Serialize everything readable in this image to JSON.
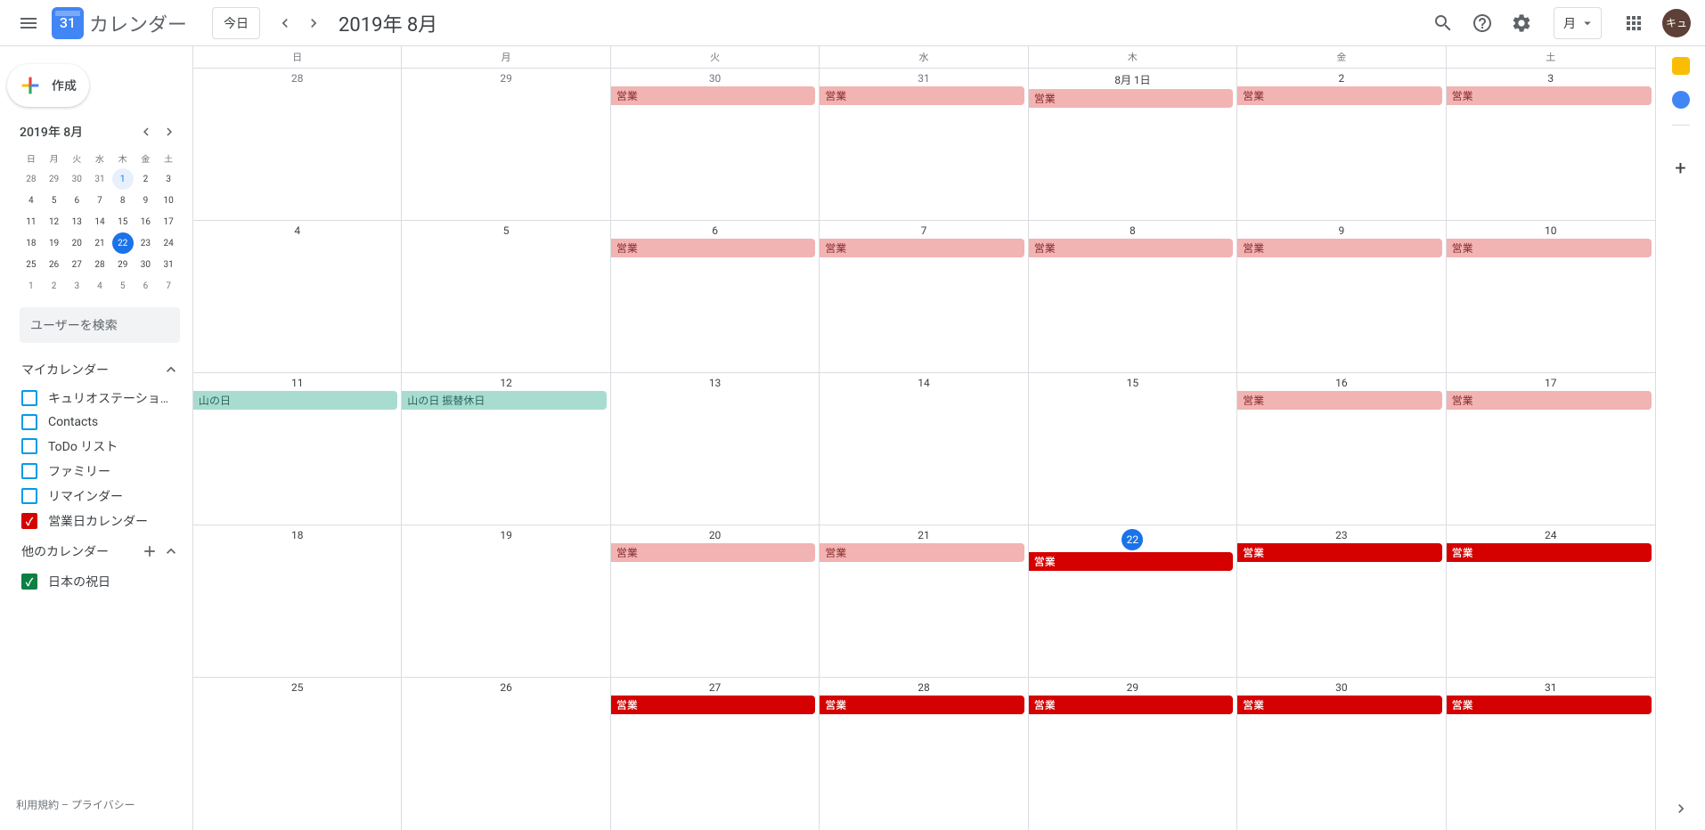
{
  "header": {
    "logo_day": "31",
    "app_title": "カレンダー",
    "today_button": "今日",
    "current_date": "2019年 8月",
    "view_label": "月",
    "avatar_initial": "キュ"
  },
  "sidebar": {
    "create_label": "作成",
    "mini_title": "2019年 8月",
    "search_placeholder": "ユーザーを検索",
    "my_cal_label": "マイカレンダー",
    "other_cal_label": "他のカレンダー",
    "dow_short": [
      "日",
      "月",
      "火",
      "水",
      "木",
      "金",
      "土"
    ],
    "mini_days": [
      [
        "28",
        "29",
        "30",
        "31",
        "1",
        "2",
        "3"
      ],
      [
        "4",
        "5",
        "6",
        "7",
        "8",
        "9",
        "10"
      ],
      [
        "11",
        "12",
        "13",
        "14",
        "15",
        "16",
        "17"
      ],
      [
        "18",
        "19",
        "20",
        "21",
        "22",
        "23",
        "24"
      ],
      [
        "25",
        "26",
        "27",
        "28",
        "29",
        "30",
        "31"
      ],
      [
        "1",
        "2",
        "3",
        "4",
        "5",
        "6",
        "7"
      ]
    ],
    "my_calendars": [
      {
        "label": "キュリオステーション志...",
        "color": "#039be5",
        "checked": false
      },
      {
        "label": "Contacts",
        "color": "#039be5",
        "checked": false
      },
      {
        "label": "ToDo リスト",
        "color": "#039be5",
        "checked": false
      },
      {
        "label": "ファミリー",
        "color": "#039be5",
        "checked": false
      },
      {
        "label": "リマインダー",
        "color": "#039be5",
        "checked": false
      },
      {
        "label": "営業日カレンダー",
        "color": "#d50000",
        "checked": true
      }
    ],
    "other_calendars": [
      {
        "label": "日本の祝日",
        "color": "#0b8043",
        "checked": true
      }
    ],
    "footer": "利用規約 – プライバシー"
  },
  "grid": {
    "dow": [
      "日",
      "月",
      "火",
      "水",
      "木",
      "金",
      "土"
    ],
    "event_labels": {
      "business": "営業",
      "mountain": "山の日",
      "mountain_sub": "山の日 振替休日"
    },
    "weeks": [
      [
        {
          "n": "28",
          "o": true
        },
        {
          "n": "29",
          "o": true
        },
        {
          "n": "30",
          "o": true,
          "e": [
            {
              "t": "business",
              "s": "pink"
            }
          ]
        },
        {
          "n": "31",
          "o": true,
          "e": [
            {
              "t": "business",
              "s": "pink"
            }
          ]
        },
        {
          "n": "8月 1日",
          "e": [
            {
              "t": "business",
              "s": "pink"
            }
          ]
        },
        {
          "n": "2",
          "e": [
            {
              "t": "business",
              "s": "pink"
            }
          ]
        },
        {
          "n": "3",
          "e": [
            {
              "t": "business",
              "s": "pink"
            }
          ]
        }
      ],
      [
        {
          "n": "4"
        },
        {
          "n": "5"
        },
        {
          "n": "6",
          "e": [
            {
              "t": "business",
              "s": "pink"
            }
          ]
        },
        {
          "n": "7",
          "e": [
            {
              "t": "business",
              "s": "pink"
            }
          ]
        },
        {
          "n": "8",
          "e": [
            {
              "t": "business",
              "s": "pink"
            }
          ]
        },
        {
          "n": "9",
          "e": [
            {
              "t": "business",
              "s": "pink"
            }
          ]
        },
        {
          "n": "10",
          "e": [
            {
              "t": "business",
              "s": "pink"
            }
          ]
        }
      ],
      [
        {
          "n": "11",
          "e": [
            {
              "t": "mountain",
              "s": "green"
            }
          ]
        },
        {
          "n": "12",
          "e": [
            {
              "t": "mountain_sub",
              "s": "green"
            }
          ]
        },
        {
          "n": "13"
        },
        {
          "n": "14"
        },
        {
          "n": "15"
        },
        {
          "n": "16",
          "e": [
            {
              "t": "business",
              "s": "pink"
            }
          ]
        },
        {
          "n": "17",
          "e": [
            {
              "t": "business",
              "s": "pink"
            }
          ]
        }
      ],
      [
        {
          "n": "18"
        },
        {
          "n": "19"
        },
        {
          "n": "20",
          "e": [
            {
              "t": "business",
              "s": "pink"
            }
          ]
        },
        {
          "n": "21",
          "e": [
            {
              "t": "business",
              "s": "pink"
            }
          ]
        },
        {
          "n": "22",
          "today": true,
          "e": [
            {
              "t": "business",
              "s": "red"
            }
          ]
        },
        {
          "n": "23",
          "e": [
            {
              "t": "business",
              "s": "red"
            }
          ]
        },
        {
          "n": "24",
          "e": [
            {
              "t": "business",
              "s": "red"
            }
          ]
        }
      ],
      [
        {
          "n": "25"
        },
        {
          "n": "26"
        },
        {
          "n": "27",
          "e": [
            {
              "t": "business",
              "s": "red"
            }
          ]
        },
        {
          "n": "28",
          "e": [
            {
              "t": "business",
              "s": "red"
            }
          ]
        },
        {
          "n": "29",
          "e": [
            {
              "t": "business",
              "s": "red"
            }
          ]
        },
        {
          "n": "30",
          "e": [
            {
              "t": "business",
              "s": "red"
            }
          ]
        },
        {
          "n": "31",
          "e": [
            {
              "t": "business",
              "s": "red"
            }
          ]
        }
      ]
    ]
  }
}
